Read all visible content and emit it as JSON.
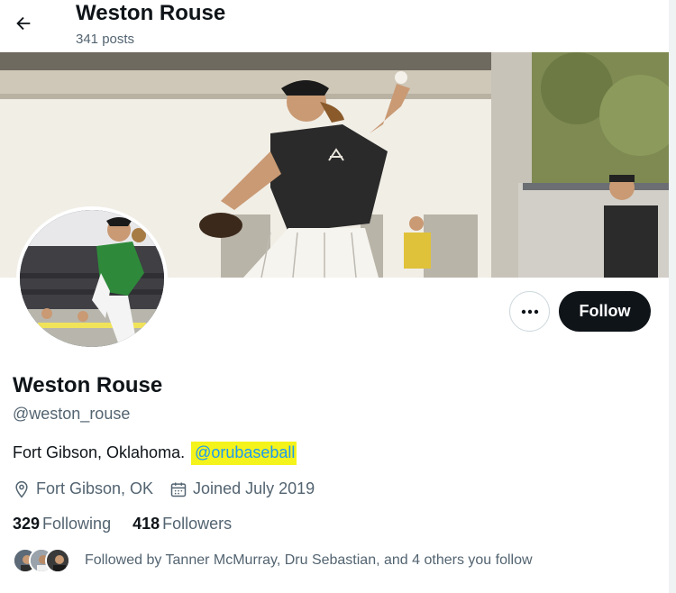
{
  "header": {
    "name": "Weston Rouse",
    "posts": "341 posts"
  },
  "profile": {
    "name": "Weston Rouse",
    "handle": "@weston_rouse",
    "bio_text": "Fort Gibson, Oklahoma.",
    "bio_link": "@orubaseball",
    "location": "Fort Gibson, OK",
    "joined": "Joined July 2019",
    "following_count": "329",
    "following_label": "Following",
    "followers_count": "418",
    "followers_label": "Followers",
    "followed_by": "Followed by Tanner McMurray, Dru Sebastian, and 4 others you follow"
  },
  "actions": {
    "follow_label": "Follow"
  },
  "colors": {
    "accent": "#1d9bf0",
    "highlight": "#f4f31b",
    "follow_bg": "#0f1419"
  },
  "icons": [
    "back-arrow-icon",
    "more-icon",
    "location-icon",
    "calendar-icon"
  ]
}
